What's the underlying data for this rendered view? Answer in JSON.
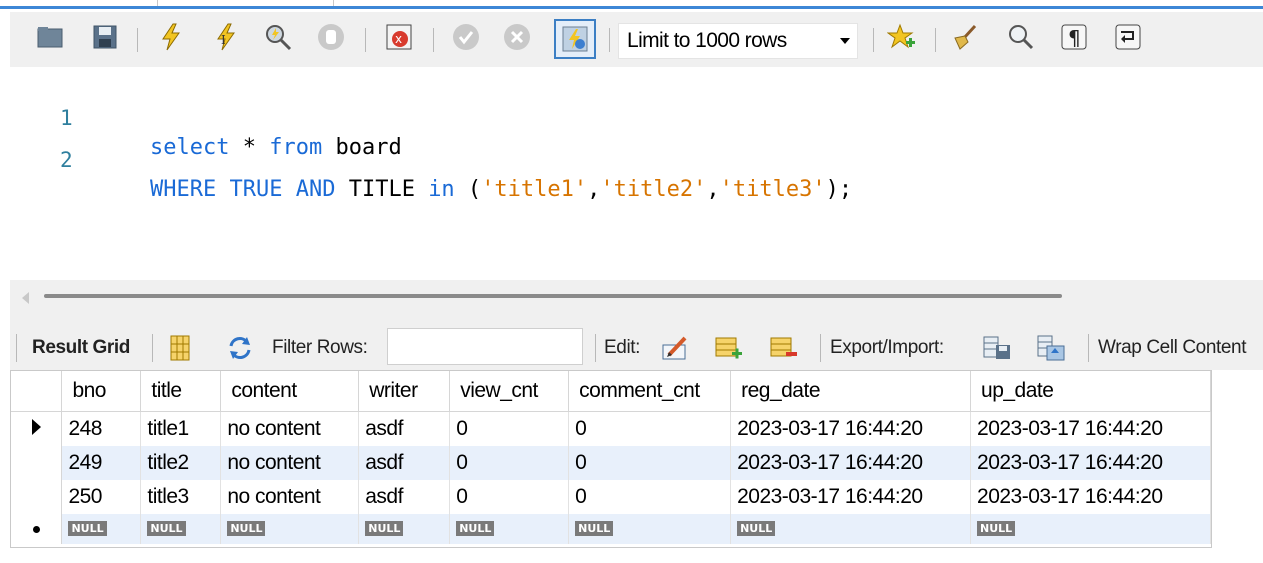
{
  "toolbar": {
    "icons": [
      "open-folder-icon",
      "save-icon",
      "execute-icon",
      "execute-current-icon",
      "explain-icon",
      "stop-icon",
      "toggle-error-icon",
      "commit-icon",
      "rollback-icon",
      "autocommit-icon",
      "add-snippet-icon",
      "beautify-icon",
      "find-icon",
      "invisible-chars-icon",
      "wrap-icon"
    ],
    "limit_label": "Limit to 1000 rows"
  },
  "editor": {
    "lines": [
      {
        "num": "1",
        "tokens": [
          {
            "t": "select",
            "c": "kw"
          },
          {
            "t": " * ",
            "c": "plain"
          },
          {
            "t": "from",
            "c": "kw"
          },
          {
            "t": " board",
            "c": "plain"
          }
        ]
      },
      {
        "num": "2",
        "tokens": [
          {
            "t": "WHERE",
            "c": "kw"
          },
          {
            "t": " ",
            "c": "plain"
          },
          {
            "t": "TRUE",
            "c": "kw"
          },
          {
            "t": " ",
            "c": "plain"
          },
          {
            "t": "AND",
            "c": "kw"
          },
          {
            "t": " TITLE ",
            "c": "plain"
          },
          {
            "t": "in",
            "c": "kw"
          },
          {
            "t": " (",
            "c": "plain"
          },
          {
            "t": "'title1'",
            "c": "str"
          },
          {
            "t": ",",
            "c": "plain"
          },
          {
            "t": "'title2'",
            "c": "str"
          },
          {
            "t": ",",
            "c": "plain"
          },
          {
            "t": "'title3'",
            "c": "str"
          },
          {
            "t": ");",
            "c": "plain"
          }
        ]
      }
    ]
  },
  "result_toolbar": {
    "result_grid": "Result Grid",
    "filter_rows": "Filter Rows:",
    "filter_value": "",
    "edit": "Edit:",
    "export_import": "Export/Import:",
    "wrap": "Wrap Cell Content"
  },
  "grid": {
    "columns": [
      "bno",
      "title",
      "content",
      "writer",
      "view_cnt",
      "comment_cnt",
      "reg_date",
      "up_date"
    ],
    "rows": [
      [
        "248",
        "title1",
        "no content",
        "asdf",
        "0",
        "0",
        "2023-03-17 16:44:20",
        "2023-03-17 16:44:20"
      ],
      [
        "249",
        "title2",
        "no content",
        "asdf",
        "0",
        "0",
        "2023-03-17 16:44:20",
        "2023-03-17 16:44:20"
      ],
      [
        "250",
        "title3",
        "no content",
        "asdf",
        "0",
        "0",
        "2023-03-17 16:44:20",
        "2023-03-17 16:44:20"
      ]
    ],
    "null_label": "NULL"
  },
  "colors": {
    "keyword": "#1a6ad6",
    "string": "#d77400",
    "line_number": "#2f7f9e",
    "alt_row": "#e8f0fb"
  }
}
